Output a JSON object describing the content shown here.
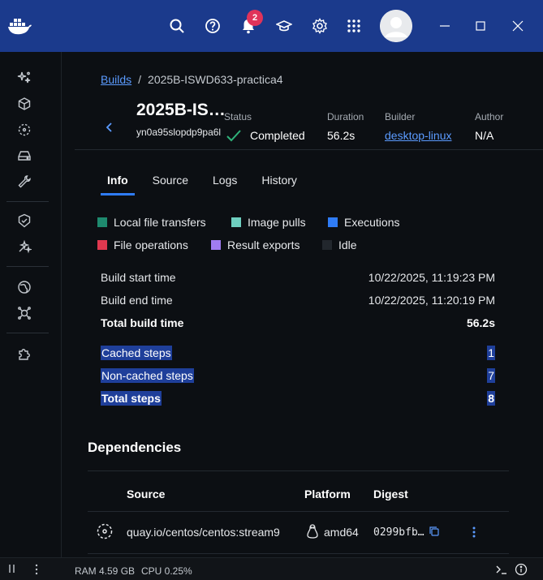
{
  "titlebar": {
    "notification_count": "2",
    "icons": [
      "docker-logo-icon",
      "search-icon",
      "help-icon",
      "bell-icon",
      "learn-icon",
      "gear-icon",
      "apps-grid-icon",
      "avatar",
      "minimize-icon",
      "maximize-icon",
      "close-icon"
    ]
  },
  "sidebar": {
    "icons": [
      "ai-sparkle-icon",
      "containers-cube-icon",
      "images-icon",
      "volumes-drive-icon",
      "builds-wrench-icon",
      "scout-shield-icon",
      "models-icon",
      "extensions-globe-icon",
      "hub-icon",
      "puzzle-icon"
    ]
  },
  "breadcrumb": {
    "root": "Builds",
    "separator": "/",
    "current": "2025B-ISWD633-practica4"
  },
  "build": {
    "title": "2025B-IS…",
    "id": "yn0a95slopdp9pa6l",
    "status_label": "Status",
    "status_value": "Completed",
    "duration_label": "Duration",
    "duration_value": "56.2s",
    "builder_label": "Builder",
    "builder_value": "desktop-linux",
    "author_label": "Author",
    "author_value": "N/A"
  },
  "tabs": [
    {
      "label": "Info",
      "active": true
    },
    {
      "label": "Source",
      "active": false
    },
    {
      "label": "Logs",
      "active": false
    },
    {
      "label": "History",
      "active": false
    }
  ],
  "legend": [
    {
      "label": "Local file transfers",
      "color": "#1e8a6e"
    },
    {
      "label": "Image pulls",
      "color": "#6fcfc0"
    },
    {
      "label": "Executions",
      "color": "#2f7cf6"
    },
    {
      "label": "File operations",
      "color": "#e0384f"
    },
    {
      "label": "Result exports",
      "color": "#a07cf0"
    },
    {
      "label": "Idle",
      "color": "#22272d"
    }
  ],
  "timing": [
    {
      "label": "Build start time",
      "value": "10/22/2025, 11:19:23 PM"
    },
    {
      "label": "Build end time",
      "value": "10/22/2025, 11:20:19 PM"
    },
    {
      "label": "Total build time",
      "value": "56.2s"
    }
  ],
  "steps": [
    {
      "label": "Cached steps",
      "value": "1"
    },
    {
      "label": "Non-cached steps",
      "value": "7"
    },
    {
      "label": "Total steps",
      "value": "8"
    }
  ],
  "dependencies": {
    "title": "Dependencies",
    "headers": {
      "source": "Source",
      "platform": "Platform",
      "digest": "Digest"
    },
    "rows": [
      {
        "source": "quay.io/centos/centos:stream9",
        "platform": "amd64",
        "digest": "0299bfb…"
      }
    ]
  },
  "statusbar": {
    "ram": "RAM 4.59 GB",
    "cpu": "CPU 0.25%"
  },
  "colors": {
    "titlebar": "#1b3a8c",
    "accent": "#2f7cf6",
    "link": "#5b9bff",
    "success": "#2fb37a"
  }
}
